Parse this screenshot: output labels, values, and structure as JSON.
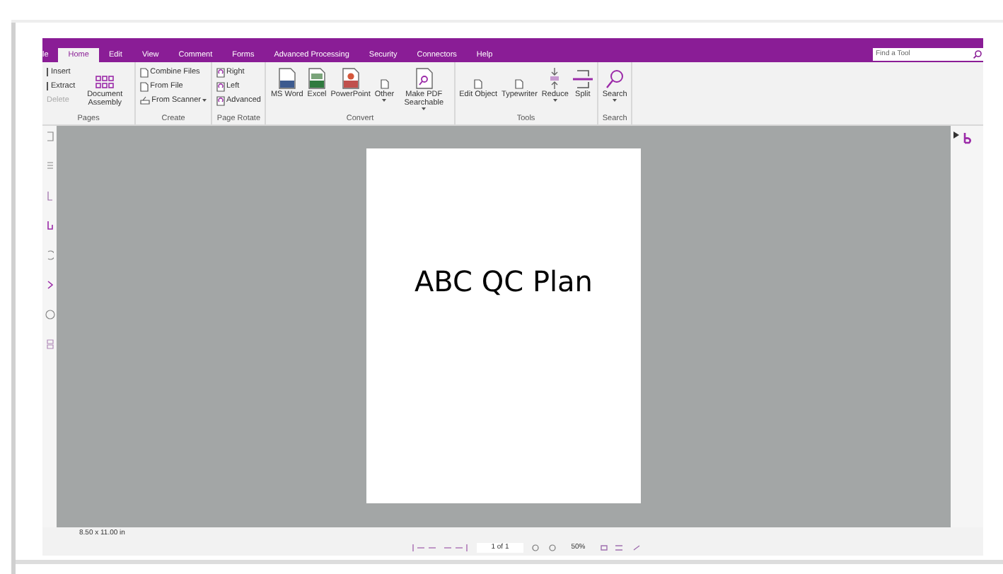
{
  "menu_tabs": [
    {
      "label": "le",
      "selected": false
    },
    {
      "label": "Home",
      "selected": true
    },
    {
      "label": "Edit",
      "selected": false
    },
    {
      "label": "View",
      "selected": false
    },
    {
      "label": "Comment",
      "selected": false
    },
    {
      "label": "Forms",
      "selected": false
    },
    {
      "label": "Advanced Processing",
      "selected": false
    },
    {
      "label": "Security",
      "selected": false
    },
    {
      "label": "Connectors",
      "selected": false
    },
    {
      "label": "Help",
      "selected": false
    }
  ],
  "find_tool": {
    "placeholder": "Find a Tool"
  },
  "ribbon_groups": [
    {
      "label": "Pages",
      "items": [
        {
          "kind": "small",
          "label": "Insert",
          "disabled": false,
          "dropdown": false
        },
        {
          "kind": "small",
          "label": "Extract",
          "disabled": false,
          "dropdown": false
        },
        {
          "kind": "small",
          "label": "Delete",
          "disabled": true,
          "dropdown": false
        },
        {
          "kind": "large",
          "label": "Document Assembly",
          "disabled": false,
          "dropdown": false
        }
      ]
    },
    {
      "label": "Create",
      "items": [
        {
          "kind": "small",
          "label": "Combine Files",
          "disabled": false,
          "dropdown": false
        },
        {
          "kind": "small",
          "label": "From File",
          "disabled": false,
          "dropdown": false
        },
        {
          "kind": "small",
          "label": "From Scanner",
          "disabled": false,
          "dropdown": true
        }
      ]
    },
    {
      "label": "Page Rotate",
      "items": [
        {
          "kind": "small",
          "label": "Right",
          "disabled": false,
          "dropdown": false
        },
        {
          "kind": "small",
          "label": "Left",
          "disabled": false,
          "dropdown": false
        },
        {
          "kind": "small",
          "label": "Advanced",
          "disabled": false,
          "dropdown": false
        }
      ]
    },
    {
      "label": "Convert",
      "items": [
        {
          "kind": "large",
          "label": "MS Word",
          "disabled": false,
          "dropdown": false
        },
        {
          "kind": "large",
          "label": "Excel",
          "disabled": false,
          "dropdown": false
        },
        {
          "kind": "large",
          "label": "PowerPoint",
          "disabled": false,
          "dropdown": false
        },
        {
          "kind": "large",
          "label": "Other",
          "disabled": false,
          "dropdown": true
        },
        {
          "kind": "large",
          "label": "Make PDF Searchable",
          "disabled": false,
          "dropdown": true
        }
      ]
    },
    {
      "label": "Tools",
      "items": [
        {
          "kind": "large",
          "label": "Edit Object",
          "disabled": false,
          "dropdown": false
        },
        {
          "kind": "large",
          "label": "Typewriter",
          "disabled": false,
          "dropdown": false
        },
        {
          "kind": "large",
          "label": "Reduce",
          "disabled": false,
          "dropdown": true
        },
        {
          "kind": "large",
          "label": "Split",
          "disabled": false,
          "dropdown": false
        }
      ]
    },
    {
      "label": "Search",
      "items": [
        {
          "kind": "large",
          "label": "Search",
          "disabled": false,
          "dropdown": true
        }
      ]
    }
  ],
  "document": {
    "text": "ABC QC Plan"
  },
  "status_bar": {
    "page_size": "8.50 x 11.00 in",
    "page_field": "1 of 1",
    "zoom": "50%"
  }
}
